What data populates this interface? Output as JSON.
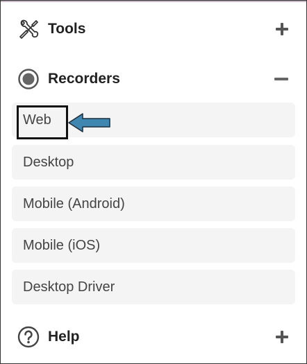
{
  "sections": {
    "tools": {
      "label": "Tools",
      "icon": "wrench-screwdriver-icon",
      "state": "collapsed"
    },
    "recorders": {
      "label": "Recorders",
      "icon": "record-icon",
      "state": "expanded"
    },
    "help": {
      "label": "Help",
      "icon": "question-circle-icon",
      "state": "collapsed"
    }
  },
  "recorders_items": [
    {
      "label": "Web"
    },
    {
      "label": "Desktop"
    },
    {
      "label": "Mobile (Android)"
    },
    {
      "label": "Mobile (iOS)"
    },
    {
      "label": "Desktop Driver"
    }
  ],
  "annotation": {
    "highlighted_item": "Web",
    "arrow_color": "#3f86b0",
    "box_color": "#111111"
  },
  "colors": {
    "item_background": "#f4f4f4",
    "text_primary": "#222222",
    "text_item": "#444444"
  }
}
